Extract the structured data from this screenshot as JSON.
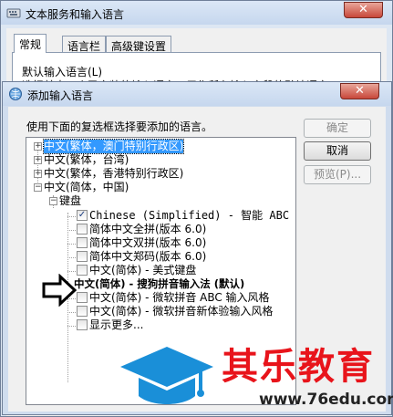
{
  "back_window": {
    "title": "文本服务和输入语言",
    "close_glyph": "✕",
    "tabs": [
      "常规",
      "语言栏",
      "高级键设置"
    ],
    "section_label": "默认输入语言(L)",
    "desc_text": "选择其中一个已安装的输入语言，用作所有输入字段的默认语言"
  },
  "dialog": {
    "title": "添加输入语言",
    "close_glyph": "✕",
    "instruction": "使用下面的复选框选择要添加的语言。",
    "ok_label": "确定",
    "cancel_label": "取消",
    "preview_label": "预览(P)..."
  },
  "tree": {
    "lang_hk_macau": "中文(繁体，澳门特别行政区)",
    "lang_taiwan": "中文(繁体，台湾)",
    "lang_hk": "中文(繁体，香港特别行政区)",
    "lang_prc": "中文(简体，中国)",
    "keyboard_group": "键盘",
    "items": [
      {
        "label": "Chinese (Simplified) - 智能 ABC (仅",
        "checked": true
      },
      {
        "label": "简体中文全拼(版本 6.0)",
        "checked": false
      },
      {
        "label": "简体中文双拼(版本 6.0)",
        "checked": false
      },
      {
        "label": "简体中文郑码(版本 6.0)",
        "checked": false
      },
      {
        "label": "中文(简体) - 美式键盘",
        "checked": false
      }
    ],
    "sogou_label": "中文(简体) - 搜狗拼音输入法 (默认)",
    "items2": [
      {
        "label": "中文(简体) - 微软拼音 ABC 输入风格",
        "checked": false
      },
      {
        "label": "中文(简体) - 微软拼音新体验输入风格",
        "checked": false
      },
      {
        "label": "显示更多...",
        "checked": false
      }
    ],
    "expand_plus": "+",
    "expand_minus": "−",
    "check_glyph": "✓"
  },
  "watermark": {
    "brand": "其乐教育",
    "url": "www.76edu.com",
    "colors": {
      "brand": "#e8141b",
      "logo": "#1a8fd8"
    }
  },
  "colors": {
    "selection": "#3399ff",
    "pointer_arrow": "#000000"
  }
}
